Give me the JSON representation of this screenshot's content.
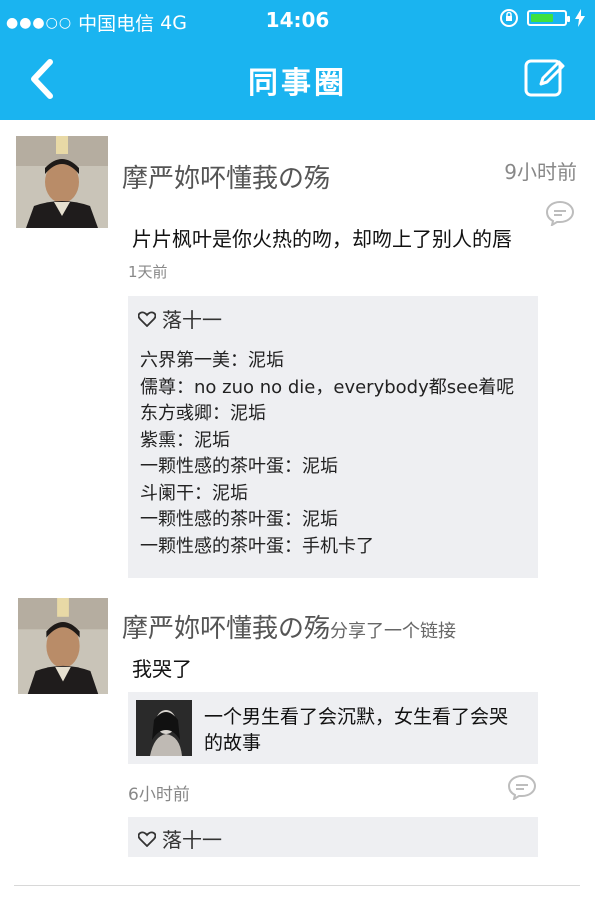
{
  "status_bar": {
    "carrier": "中国电信",
    "network": "4G",
    "time": "14:06",
    "signal_dots": "●●●○○",
    "icons": [
      "rotation-lock-icon",
      "battery-icon",
      "charging-icon"
    ],
    "battery_level": 0.7
  },
  "nav": {
    "title": "同事圈",
    "back_icon": "back-arrow-icon",
    "edit_icon": "edit-icon"
  },
  "posts": [
    {
      "author": "摩严妳吥懂莪の殇",
      "time": "9小时前",
      "text": "片片枫叶是你火热的吻，却吻上了别人的唇",
      "date": "1天前",
      "like": "落十一",
      "comments": [
        "六界第一美：泥垢",
        "儒尊：no zuo no die，everybody都see着呢",
        "东方彧卿：泥垢",
        "紫熏：泥垢",
        "一颗性感的茶叶蛋：泥垢",
        "斗阑干：泥垢",
        "一颗性感的茶叶蛋：泥垢",
        "一颗性感的茶叶蛋：手机卡了"
      ]
    },
    {
      "author": "摩严妳吥懂莪の殇",
      "action": "分享了一个链接",
      "text": "我哭了",
      "link_title": "一个男生看了会沉默，女生看了会哭的故事",
      "date": "6小时前",
      "like": "落十一"
    }
  ],
  "colors": {
    "accent": "#1ab4f0",
    "panel": "#eeeff2"
  }
}
